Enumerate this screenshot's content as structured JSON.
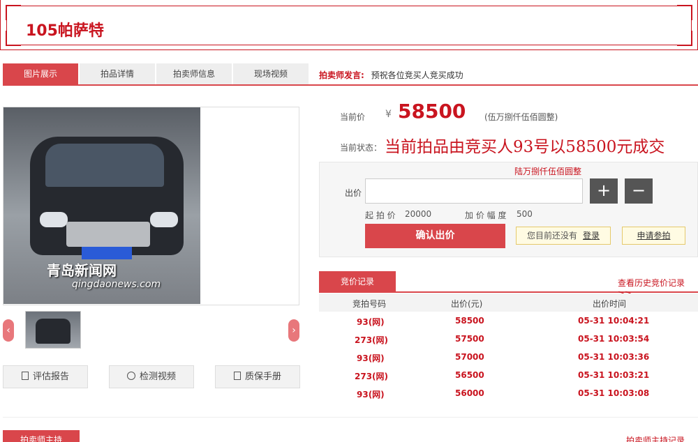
{
  "header": {
    "title": "105帕萨特"
  },
  "tabs": [
    {
      "label": "图片展示"
    },
    {
      "label": "拍品详情"
    },
    {
      "label": "拍卖师信息"
    },
    {
      "label": "现场视频"
    }
  ],
  "announcement": {
    "label": "拍卖师发言:",
    "text": "预祝各位竞买人竞买成功"
  },
  "gallery": {
    "watermark_cn": "青岛新闻网",
    "watermark_en": "qingdaonews.com",
    "prev_arrow": "‹",
    "next_arrow": "›"
  },
  "actions": [
    {
      "label": "评估报告",
      "icon": "document-icon"
    },
    {
      "label": "检测视频",
      "icon": "play-icon"
    },
    {
      "label": "质保手册",
      "icon": "manual-icon"
    }
  ],
  "price": {
    "current_label": "当前价",
    "currency": "¥",
    "value": "58500",
    "value_cn": "(伍万捌仟伍佰圆整)",
    "status_label": "当前状态：",
    "status_text": "当前拍品由竞买人93号以58500元成交"
  },
  "bid": {
    "amount_cn": "陆万捌仟伍佰圆整",
    "label": "出价",
    "input_value": "",
    "plus": "+",
    "minus": "−",
    "start_label": "起 拍 价",
    "start_value": "20000",
    "increment_label": "加 价 幅 度",
    "increment_value": "500",
    "confirm_label": "确认出价",
    "login_note": "您目前还没有",
    "login_link": "登录",
    "apply_label": "申请参拍"
  },
  "records": {
    "tab_label": "竞价记录",
    "history_link": "查看历史竞价记录>>",
    "columns": [
      "竞拍号码",
      "出价(元)",
      "出价时间"
    ],
    "rows": [
      [
        "93(网)",
        "58500",
        "05-31 10:04:21"
      ],
      [
        "273(网)",
        "57500",
        "05-31 10:03:54"
      ],
      [
        "93(网)",
        "57000",
        "05-31 10:03:36"
      ],
      [
        "273(网)",
        "56500",
        "05-31 10:03:21"
      ],
      [
        "93(网)",
        "56000",
        "05-31 10:03:08"
      ]
    ]
  },
  "footer": {
    "tab_label": "拍卖师主持",
    "link": "拍卖师主持记录>>"
  },
  "colors": {
    "accent": "#d9464b",
    "brand_red": "#c9141f"
  }
}
